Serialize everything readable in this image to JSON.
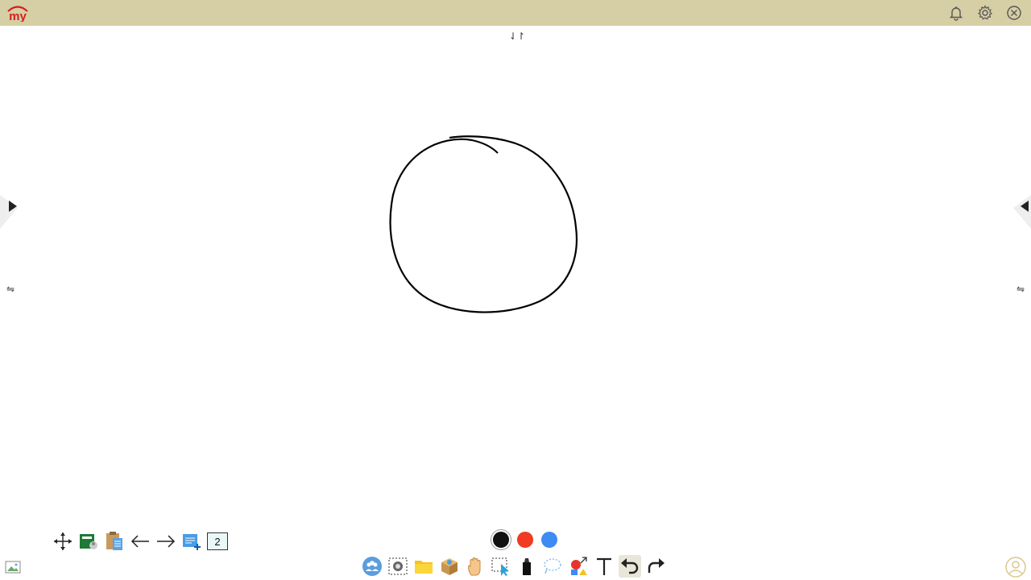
{
  "app": {
    "logo_text": "my"
  },
  "header": {
    "icons": [
      "bell-icon",
      "gear-icon",
      "close-icon"
    ]
  },
  "canvas": {
    "toggle_glyph": "⇃↾",
    "swap_glyph": "⇋"
  },
  "toolbar_left": {
    "icons": [
      "move-icon",
      "spreadsheet-icon",
      "clipboard-icon",
      "arrow-left-icon",
      "arrow-right-icon",
      "add-page-icon"
    ],
    "page_number": "2"
  },
  "palette": {
    "colors": [
      "#111111",
      "#f03a21",
      "#3d8bf3"
    ]
  },
  "toolbar_bottom": {
    "icons": [
      "users-icon",
      "screenshot-icon",
      "folder-icon",
      "box-icon",
      "hand-icon",
      "select-icon",
      "marker-icon",
      "lasso-icon",
      "shapes-icon",
      "text-icon",
      "undo-icon",
      "redo-icon"
    ],
    "active": "undo-icon"
  }
}
